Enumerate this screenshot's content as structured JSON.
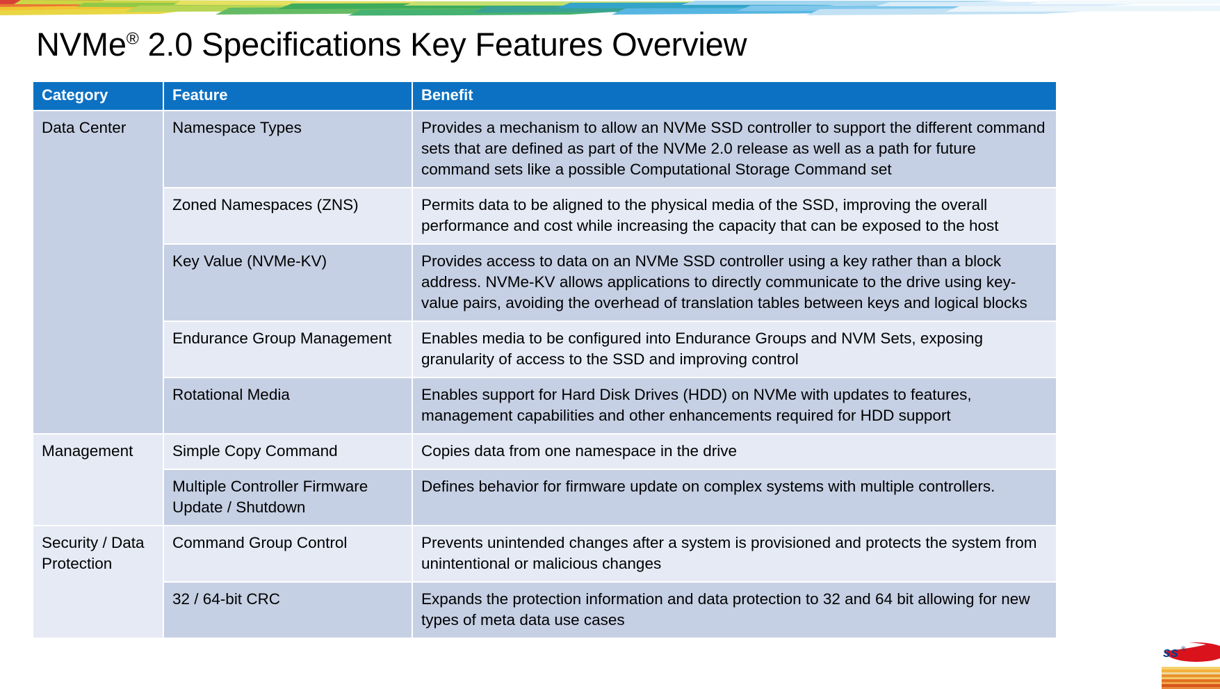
{
  "slide": {
    "title_main": "NVMe",
    "title_sup": "®",
    "title_rest": " 2.0 Specifications Key Features Overview"
  },
  "table": {
    "headers": {
      "category": "Category",
      "feature": "Feature",
      "benefit": "Benefit"
    },
    "colors": {
      "header_bg": "#0C71C3",
      "header_text": "#FFFFFF",
      "row_dark": "#C6D0E4",
      "row_light": "#E5EAF5",
      "body_text": "#000000"
    },
    "groups": [
      {
        "category": "Data Center",
        "rows": [
          {
            "feature": "Namespace Types",
            "benefit": "Provides a mechanism to allow an NVMe SSD controller to support the different command sets that are defined as part of the NVMe 2.0 release as well as a path for future command sets like a possible Computational Storage Command set"
          },
          {
            "feature": "Zoned Namespaces (ZNS)",
            "benefit": "Permits data to be aligned to the physical media of the SSD, improving the overall performance and cost while increasing the capacity that can be exposed to the host"
          },
          {
            "feature": "Key Value (NVMe-KV)",
            "benefit": "Provides access to data on an NVMe SSD controller using a key rather than a block address. NVMe-KV allows applications to directly communicate to the drive using key-value pairs, avoiding the overhead of translation tables between keys and logical blocks"
          },
          {
            "feature": "Endurance Group Management",
            "benefit": "Enables media to be configured into Endurance Groups and NVM Sets, exposing granularity of access to the SSD and improving control"
          },
          {
            "feature": "Rotational Media",
            "benefit": "Enables support for Hard Disk Drives (HDD) on NVMe with updates to features, management capabilities and other enhancements required for HDD support"
          }
        ]
      },
      {
        "category": "Management",
        "rows": [
          {
            "feature": "Simple Copy Command",
            "benefit": "Copies data from one namespace in the drive"
          },
          {
            "feature": "Multiple Controller Firmware Update / Shutdown",
            "benefit": "Defines behavior for firmware update on complex systems with multiple controllers."
          }
        ]
      },
      {
        "category": "Security / Data Protection",
        "rows": [
          {
            "feature": "Command Group Control",
            "benefit": "Prevents unintended changes after a system is provisioned and protects the system from unintentional or malicious changes"
          },
          {
            "feature": "32 / 64-bit CRC",
            "benefit": "Expands the protection information and data protection to 32 and 64 bit allowing for new types of meta data use cases"
          }
        ]
      }
    ]
  },
  "logo": {
    "text_fragment": "ss",
    "registered_mark": "®",
    "swoosh_color": "#D9121C",
    "text_color": "#0B3E8C"
  }
}
